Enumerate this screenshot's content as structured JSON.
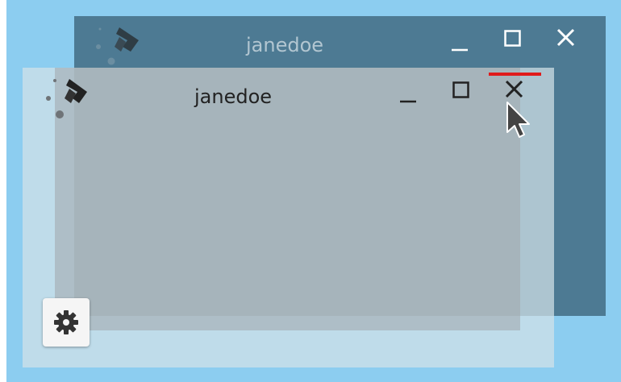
{
  "windows": {
    "back": {
      "title": "janedoe"
    },
    "front": {
      "title": "janedoe"
    }
  },
  "colors": {
    "desktop": "#8ccdf0",
    "back_window": "#4d7a93",
    "active_indicator": "#e01b1b"
  },
  "icons": {
    "logo": "logo-icon",
    "minimize": "minimize-icon",
    "maximize": "maximize-icon",
    "close": "close-icon",
    "settings": "gear-icon",
    "cursor": "mouse-cursor-icon"
  }
}
